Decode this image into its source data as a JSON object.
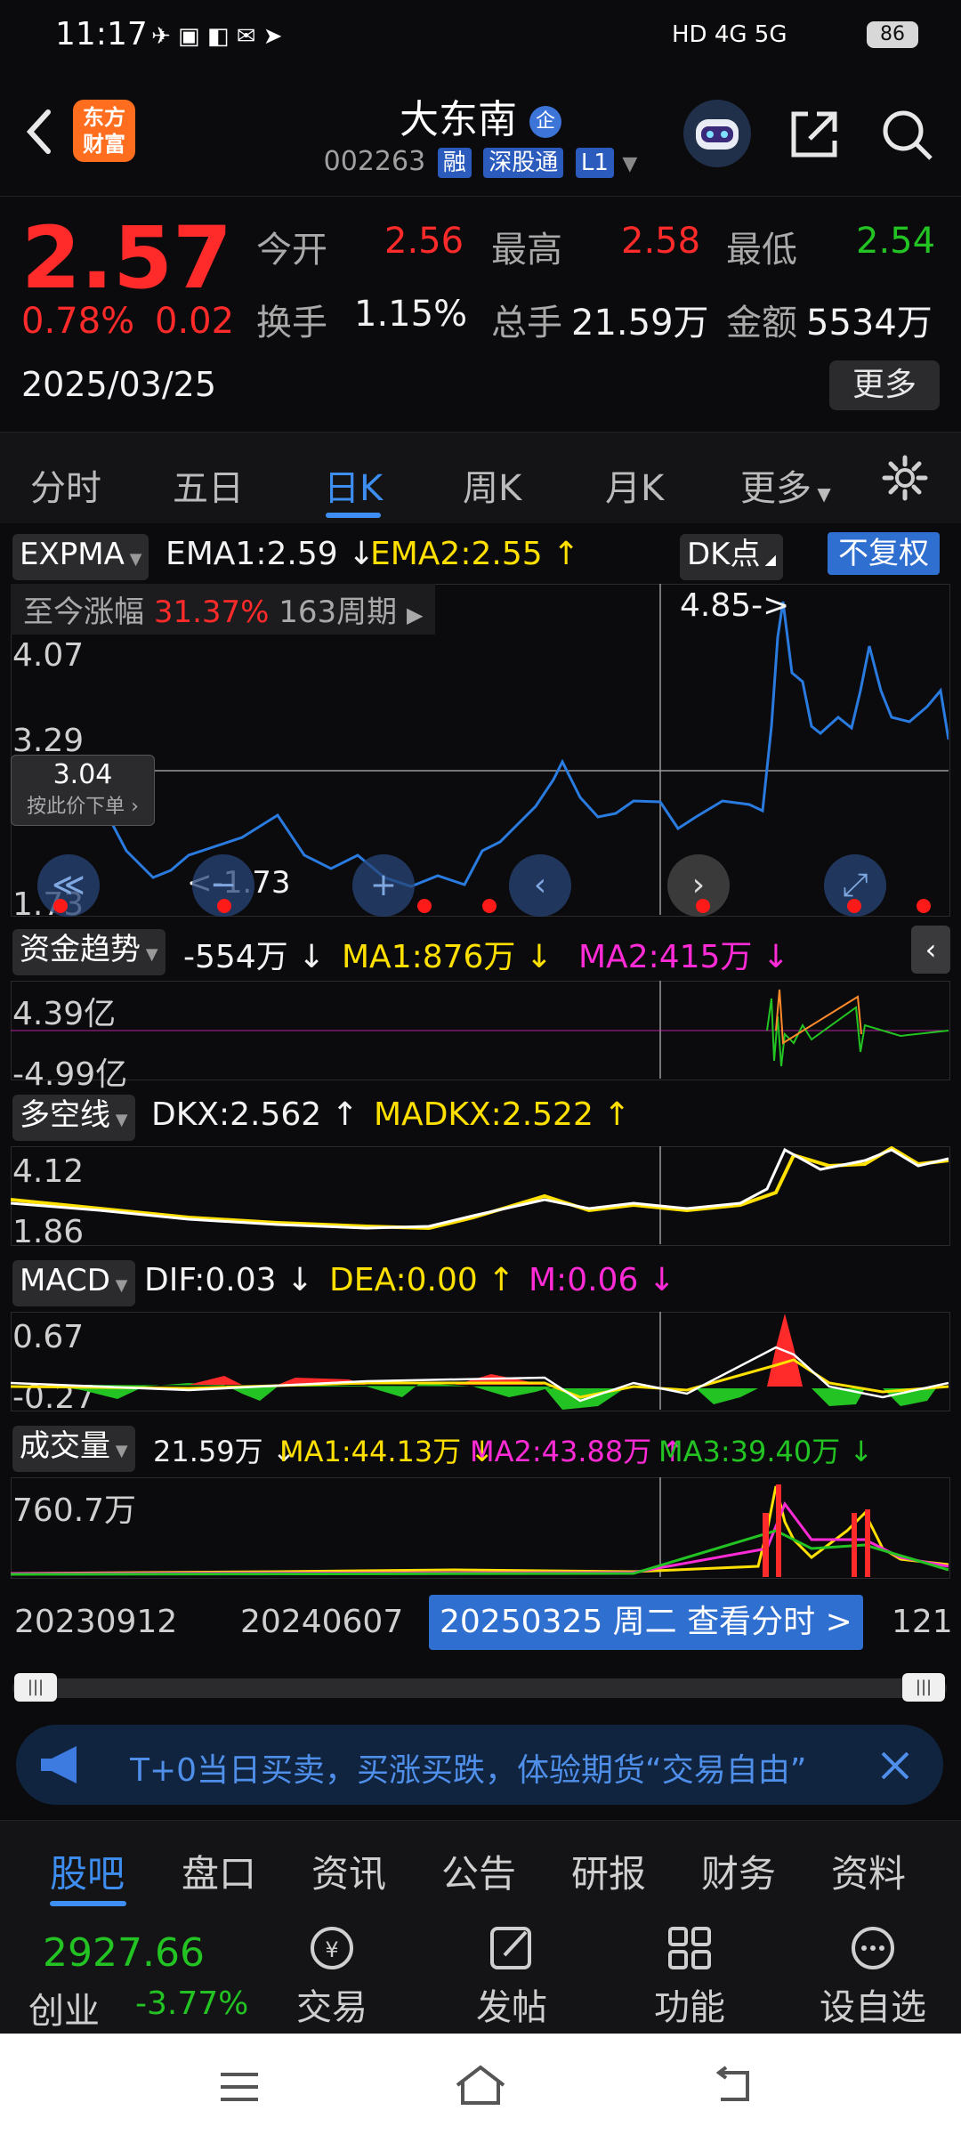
{
  "status_bar": {
    "time": "11:17",
    "network": "HD 4G 5G",
    "battery": "86"
  },
  "header": {
    "logo_text": "东方财富",
    "stock_name": "大东南",
    "badge": "企",
    "code": "002263",
    "tags": [
      "融",
      "深股通",
      "L1"
    ]
  },
  "quote": {
    "price": "2.57",
    "change_pct": "0.78%",
    "change_amt": "0.02",
    "date": "2025/03/25",
    "open_label": "今开",
    "open": "2.56",
    "high_label": "最高",
    "high": "2.58",
    "low_label": "最低",
    "low": "2.54",
    "turnover_label": "换手",
    "turnover": "1.15%",
    "volume_label": "总手",
    "volume": "21.59万",
    "amount_label": "金额",
    "amount": "5534万",
    "more_label": "更多"
  },
  "tabs": [
    "分时",
    "五日",
    "日K",
    "周K",
    "月K",
    "更多"
  ],
  "active_tab": 2,
  "chart": {
    "main_indicator": "EXPMA",
    "ema1": "EMA1:2.59 ↓",
    "ema2": "EMA2:2.55 ↑",
    "dk_label": "DK点",
    "adjust_label": "不复权",
    "gain_label": "至今涨幅",
    "gain_value": "31.37%",
    "gain_period": "163周期",
    "y_labels": [
      "4.07",
      "3.29",
      "1.73"
    ],
    "high_marker": "4.85->",
    "low_marker": "<-1.73",
    "crosshair_price": "3.04",
    "crosshair_hint": "按此价下单",
    "fund_indicator": "资金趋势",
    "fund_value": "-554万 ↓",
    "fund_ma1": "MA1:876万 ↓",
    "fund_ma2": "MA2:415万 ↓",
    "fund_y": [
      "4.39亿",
      "-4.99亿"
    ],
    "dkx_indicator": "多空线",
    "dkx": "DKX:2.562 ↑",
    "madkx": "MADKX:2.522 ↑",
    "dkx_y": [
      "4.12",
      "1.86"
    ],
    "macd_indicator": "MACD",
    "dif": "DIF:0.03 ↓",
    "dea": "DEA:0.00 ↑",
    "m": "M:0.06 ↓",
    "macd_y": [
      "0.67",
      "-0.27"
    ],
    "vol_indicator": "成交量",
    "vol": "21.59万 ↓",
    "vol_ma1": "MA1:44.13万 ↓",
    "vol_ma2": "MA2:43.88万 ↑",
    "vol_ma3": "MA3:39.40万 ↓",
    "vol_y": "760.7万",
    "x_labels": [
      "20230912",
      "20240607",
      "121"
    ],
    "crosshair_date": "20250325 周二 查看分时 >"
  },
  "banner": {
    "text": "T+0当日买卖，买涨买跌，体验期货“交易自由”"
  },
  "bottom_tabs": [
    "股吧",
    "盘口",
    "资讯",
    "公告",
    "研报",
    "财务",
    "资料"
  ],
  "dock": {
    "index_value": "2927.66",
    "index_name": "创业",
    "index_change": "-3.77%",
    "trade_label": "交易",
    "post_label": "发帖",
    "func_label": "功能",
    "watch_label": "设自选"
  },
  "colors": {
    "up": "#ff2a2a",
    "down": "#22c322",
    "accent": "#2a7be0",
    "ma1": "#ffe000",
    "ma2": "#ff2bd6"
  }
}
